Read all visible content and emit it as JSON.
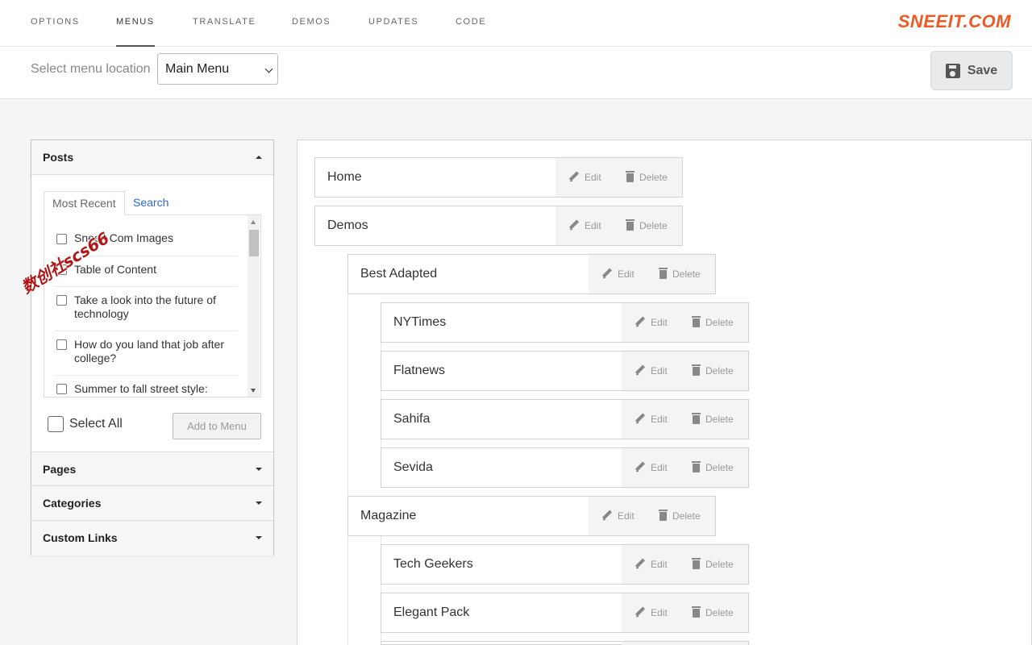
{
  "nav": {
    "tabs": [
      {
        "label": "OPTIONS"
      },
      {
        "label": "MENUS",
        "active": true
      },
      {
        "label": "TRANSLATE"
      },
      {
        "label": "DEMOS"
      },
      {
        "label": "UPDATES"
      },
      {
        "label": "CODE"
      }
    ],
    "brand": "SNEEIT.COM"
  },
  "location": {
    "label": "Select menu location",
    "selected": "Main Menu"
  },
  "toolbar": {
    "save_label": "Save",
    "save_icon": "floppy-disk-icon"
  },
  "left_panel": {
    "posts": {
      "title": "Posts",
      "expanded": true,
      "tabs": {
        "recent": "Most Recent",
        "search": "Search"
      },
      "items": [
        "Sneeit.Com Images",
        "Table of Content",
        "Take a look into the future of technology",
        "How do you land that job after college?",
        "Summer to fall street style:"
      ],
      "select_all": "Select All",
      "add_button": "Add to Menu"
    },
    "sections": [
      {
        "title": "Pages"
      },
      {
        "title": "Categories"
      },
      {
        "title": "Custom Links"
      }
    ]
  },
  "menu_tree": {
    "edit_label": "Edit",
    "delete_label": "Delete",
    "items": [
      {
        "name": "Home",
        "depth": 0
      },
      {
        "name": "Demos",
        "depth": 0
      },
      {
        "name": "Best Adapted",
        "depth": 1
      },
      {
        "name": "NYTimes",
        "depth": 2
      },
      {
        "name": "Flatnews",
        "depth": 2
      },
      {
        "name": "Sahifa",
        "depth": 2
      },
      {
        "name": "Sevida",
        "depth": 2
      },
      {
        "name": "Magazine",
        "depth": 1
      },
      {
        "name": "Tech Geekers",
        "depth": 2
      },
      {
        "name": "Elegant Pack",
        "depth": 2
      }
    ]
  },
  "watermark": "数创社scs66"
}
